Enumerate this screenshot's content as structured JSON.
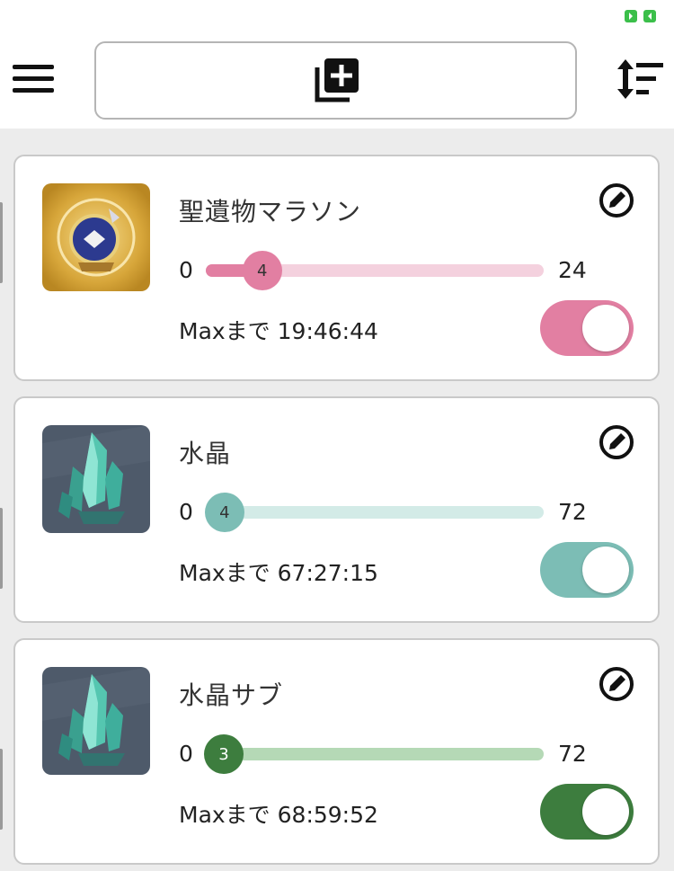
{
  "header": {
    "menu_icon": "hamburger-icon",
    "add_icon": "add-to-queue-icon",
    "sort_icon": "sort-icon",
    "status_icon": "battery-icon"
  },
  "cards": [
    {
      "title": "聖遺物マラソン",
      "min": "0",
      "max": "24",
      "value": "4",
      "progress": 0.1667,
      "timer": "Maxまで 19:46:44",
      "toggle_on": true,
      "accent": "#e27fa2",
      "track_color": "#f4d1de",
      "knob_text_color": "#333333",
      "thumbnail": "artifact-icon"
    },
    {
      "title": "水晶",
      "min": "0",
      "max": "72",
      "value": "4",
      "progress": 0.0556,
      "timer": "Maxまで 67:27:15",
      "toggle_on": true,
      "accent": "#7cbdb5",
      "track_color": "#d3ebe7",
      "knob_text_color": "#333333",
      "thumbnail": "crystal-icon"
    },
    {
      "title": "水晶サブ",
      "min": "0",
      "max": "72",
      "value": "3",
      "progress": 0.0417,
      "timer": "Maxまで 68:59:52",
      "toggle_on": true,
      "accent": "#3d7d3e",
      "track_color": "#b5d9b6",
      "knob_text_color": "#ffffff",
      "thumbnail": "crystal-icon"
    }
  ]
}
